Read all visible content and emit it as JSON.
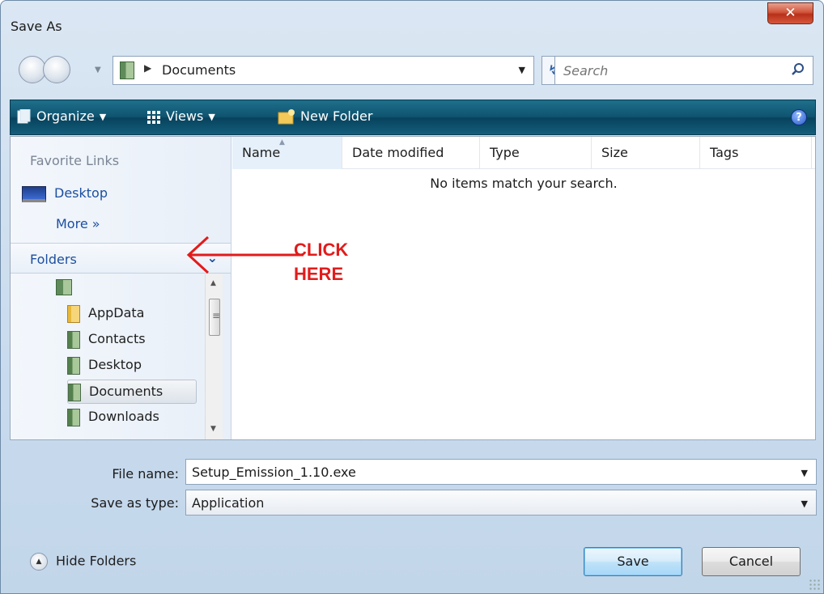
{
  "window": {
    "title": "Save As"
  },
  "address": {
    "path": "Documents"
  },
  "search": {
    "placeholder": "Search"
  },
  "toolbar": {
    "organize_label": "Organize",
    "views_label": "Views",
    "new_folder_label": "New Folder"
  },
  "nav": {
    "favorites_title": "Favorite Links",
    "desktop_label": "Desktop",
    "more_label": "More",
    "folders_title": "Folders"
  },
  "tree": {
    "items": [
      {
        "label": "AppData",
        "icon": "folder-icon"
      },
      {
        "label": "Contacts",
        "icon": "contacts-icon"
      },
      {
        "label": "Desktop",
        "icon": "desktop-folder-icon"
      },
      {
        "label": "Documents",
        "icon": "documents-folder-icon",
        "selected": true
      },
      {
        "label": "Downloads",
        "icon": "downloads-folder-icon"
      }
    ]
  },
  "annotation": {
    "line1": "CLICK",
    "line2": "HERE",
    "color": "#e31b1b"
  },
  "columns": [
    "Name",
    "Date modified",
    "Type",
    "Size",
    "Tags"
  ],
  "empty_message": "No items match your search.",
  "form": {
    "file_name_label": "File name:",
    "file_name_value": "Setup_Emission_1.10.exe",
    "save_type_label": "Save as type:",
    "save_type_value": "Application"
  },
  "footer": {
    "hide_folders_label": "Hide Folders",
    "save_label": "Save",
    "cancel_label": "Cancel"
  },
  "colors": {
    "toolbar": "#0f5470",
    "link": "#1c4fa0",
    "close_button": "#c8452c"
  }
}
